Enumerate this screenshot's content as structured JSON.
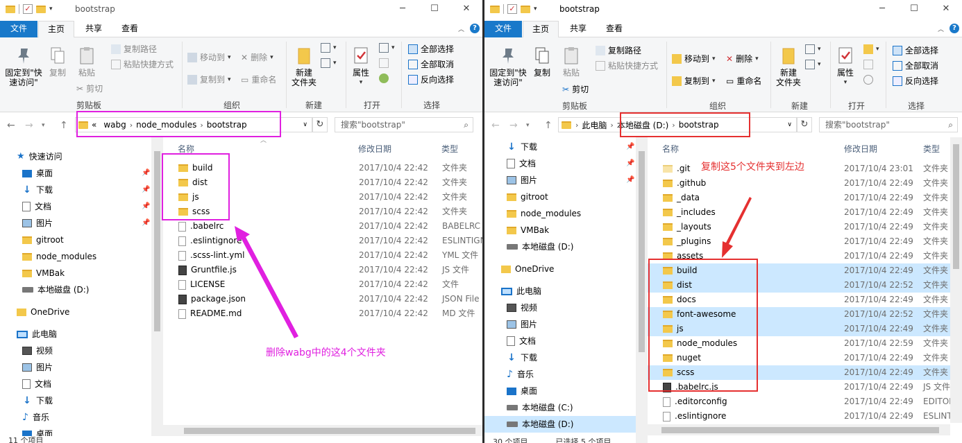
{
  "left": {
    "title": "bootstrap",
    "tabs": [
      "文件",
      "主页",
      "共享",
      "查看"
    ],
    "ribbon": {
      "pin_label": "固定到\"快速访问\"",
      "copy_label": "复制",
      "paste_label": "粘贴",
      "copy_path": "复制路径",
      "paste_shortcut": "粘贴快捷方式",
      "cut": "剪切",
      "move_to": "移动到",
      "copy_to": "复制到",
      "delete": "删除",
      "rename": "重命名",
      "new_folder": "新建\n文件夹",
      "properties": "属性",
      "select_all": "全部选择",
      "select_none": "全部取消",
      "invert": "反向选择",
      "groups": [
        "剪贴板",
        "组织",
        "新建",
        "打开",
        "选择"
      ]
    },
    "address": {
      "prefix": "«",
      "crumbs": [
        "wabg",
        "node_modules",
        "bootstrap"
      ]
    },
    "search_placeholder": "搜索\"bootstrap\"",
    "nav": [
      "快速访问",
      "桌面",
      "下载",
      "文档",
      "图片",
      "gitroot",
      "node_modules",
      "VMBak",
      "本地磁盘 (D:)",
      "OneDrive",
      "此电脑",
      "视频",
      "图片",
      "文档",
      "下载",
      "音乐",
      "桌面"
    ],
    "columns": [
      "名称",
      "修改日期",
      "类型"
    ],
    "files": [
      {
        "name": "build",
        "date": "2017/10/4 22:42",
        "type": "文件夹"
      },
      {
        "name": "dist",
        "date": "2017/10/4 22:42",
        "type": "文件夹"
      },
      {
        "name": "js",
        "date": "2017/10/4 22:42",
        "type": "文件夹"
      },
      {
        "name": "scss",
        "date": "2017/10/4 22:42",
        "type": "文件夹"
      },
      {
        "name": ".babelrc",
        "date": "2017/10/4 22:42",
        "type": "BABELRC 文"
      },
      {
        "name": ".eslintignore",
        "date": "2017/10/4 22:42",
        "type": "ESLINTIGN"
      },
      {
        "name": ".scss-lint.yml",
        "date": "2017/10/4 22:42",
        "type": "YML 文件"
      },
      {
        "name": "Gruntfile.js",
        "date": "2017/10/4 22:42",
        "type": "JS 文件"
      },
      {
        "name": "LICENSE",
        "date": "2017/10/4 22:42",
        "type": "文件"
      },
      {
        "name": "package.json",
        "date": "2017/10/4 22:42",
        "type": "JSON File"
      },
      {
        "name": "README.md",
        "date": "2017/10/4 22:42",
        "type": "MD 文件"
      }
    ],
    "status": "11 个项目",
    "annotation": "删除wabg中的这4个文件夹"
  },
  "right": {
    "title": "bootstrap",
    "tabs": [
      "文件",
      "主页",
      "共享",
      "查看"
    ],
    "address": {
      "crumbs": [
        "此电脑",
        "本地磁盘 (D:)",
        "bootstrap"
      ]
    },
    "search_placeholder": "搜索\"bootstrap\"",
    "nav": [
      "下载",
      "文档",
      "图片",
      "gitroot",
      "node_modules",
      "VMBak",
      "本地磁盘 (D:)",
      "OneDrive",
      "此电脑",
      "视频",
      "图片",
      "文档",
      "下载",
      "音乐",
      "桌面",
      "本地磁盘 (C:)",
      "本地磁盘 (D:)"
    ],
    "columns": [
      "名称",
      "修改日期",
      "类型"
    ],
    "files": [
      {
        "name": ".git",
        "date": "2017/10/4 23:01",
        "type": "文件夹"
      },
      {
        "name": ".github",
        "date": "2017/10/4 22:49",
        "type": "文件夹"
      },
      {
        "name": "_data",
        "date": "2017/10/4 22:49",
        "type": "文件夹"
      },
      {
        "name": "_includes",
        "date": "2017/10/4 22:49",
        "type": "文件夹"
      },
      {
        "name": "_layouts",
        "date": "2017/10/4 22:49",
        "type": "文件夹"
      },
      {
        "name": "_plugins",
        "date": "2017/10/4 22:49",
        "type": "文件夹"
      },
      {
        "name": "assets",
        "date": "2017/10/4 22:49",
        "type": "文件夹"
      },
      {
        "name": "build",
        "date": "2017/10/4 22:49",
        "type": "文件夹"
      },
      {
        "name": "dist",
        "date": "2017/10/4 22:52",
        "type": "文件夹"
      },
      {
        "name": "docs",
        "date": "2017/10/4 22:49",
        "type": "文件夹"
      },
      {
        "name": "font-awesome",
        "date": "2017/10/4 22:52",
        "type": "文件夹"
      },
      {
        "name": "js",
        "date": "2017/10/4 22:49",
        "type": "文件夹"
      },
      {
        "name": "node_modules",
        "date": "2017/10/4 22:59",
        "type": "文件夹"
      },
      {
        "name": "nuget",
        "date": "2017/10/4 22:49",
        "type": "文件夹"
      },
      {
        "name": "scss",
        "date": "2017/10/4 22:49",
        "type": "文件夹"
      },
      {
        "name": ".babelrc.js",
        "date": "2017/10/4 22:49",
        "type": "JS 文件"
      },
      {
        "name": ".editorconfig",
        "date": "2017/10/4 22:49",
        "type": "EDITOR"
      },
      {
        "name": ".eslintignore",
        "date": "2017/10/4 22:49",
        "type": "ESLINT"
      }
    ],
    "status": "30 个项目",
    "status_selected": "已选择 5 个项目",
    "annotation": "复制这5个文件夹到左边"
  },
  "colors": {
    "accent": "#1979ca",
    "selection": "#cce8ff",
    "magenta": "#e020e0",
    "red": "#e53030"
  }
}
